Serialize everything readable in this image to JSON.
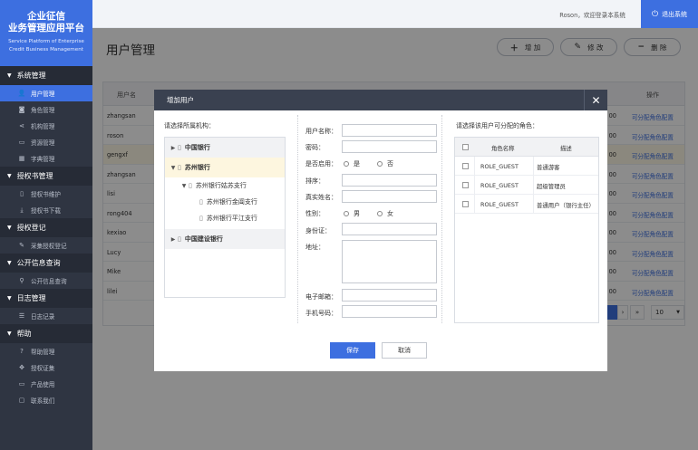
{
  "brand": {
    "title1": "企业征信",
    "title2": "业务管理应用平台",
    "sub1": "Service Platform of Enterprise",
    "sub2": "Credit Business Management"
  },
  "sidebar": {
    "groups": [
      {
        "label": "系统管理",
        "items": [
          {
            "label": "用户管理",
            "icon": "user-icon",
            "active": true
          },
          {
            "label": "角色管理",
            "icon": "role-icon"
          },
          {
            "label": "机构管理",
            "icon": "share-icon"
          },
          {
            "label": "资源管理",
            "icon": "folder-icon"
          },
          {
            "label": "字典管理",
            "icon": "calendar-icon"
          }
        ]
      },
      {
        "label": "授权书管理",
        "items": [
          {
            "label": "授权书维护",
            "icon": "document-icon"
          },
          {
            "label": "授权书下载",
            "icon": "download-icon"
          }
        ]
      },
      {
        "label": "授权登记",
        "items": [
          {
            "label": "采集授权登记",
            "icon": "pen-icon"
          }
        ]
      },
      {
        "label": "公开信息查询",
        "items": [
          {
            "label": "公开信息查询",
            "icon": "search-icon"
          }
        ]
      },
      {
        "label": "日志管理",
        "items": [
          {
            "label": "日志记录",
            "icon": "list-icon"
          }
        ]
      },
      {
        "label": "帮助",
        "items": [
          {
            "label": "帮助管理",
            "icon": "help-icon"
          },
          {
            "label": "授权证集",
            "icon": "move-icon"
          },
          {
            "label": "产品使用",
            "icon": "monitor-icon"
          },
          {
            "label": "联系我们",
            "icon": "chat-icon"
          }
        ]
      }
    ]
  },
  "topbar": {
    "welcome": "Roson，欢迎登录本系统",
    "logout": "退出系统"
  },
  "page": {
    "title": "用户管理",
    "add_label": "增 加",
    "edit_label": "修 改",
    "delete_label": "删 除"
  },
  "grid": {
    "header_name": "用户名",
    "header_op": "操作",
    "rows": [
      {
        "name": "zhangsan",
        "mid": "00",
        "op": "可分配角色配置"
      },
      {
        "name": "roson",
        "mid": "00",
        "op": "可分配角色配置"
      },
      {
        "name": "gengxf",
        "mid": "00",
        "op": "可分配角色配置"
      },
      {
        "name": "zhangsan",
        "mid": "00",
        "op": "可分配角色配置"
      },
      {
        "name": "lisi",
        "mid": "00",
        "op": "可分配角色配置"
      },
      {
        "name": "rong404",
        "mid": "00",
        "op": "可分配角色配置"
      },
      {
        "name": "kexiao",
        "mid": "00",
        "op": "可分配角色配置"
      },
      {
        "name": "Lucy",
        "mid": "00",
        "op": "可分配角色配置"
      },
      {
        "name": "Mike",
        "mid": "00",
        "op": "可分配角色配置"
      },
      {
        "name": "lilei",
        "mid": "00",
        "op": "可分配角色配置"
      }
    ],
    "pager_next": "›",
    "pager_last": "»",
    "page_size": "10"
  },
  "modal": {
    "title": "增加用户",
    "org_label": "请选择所属机构：",
    "tree": [
      "中国银行",
      "苏州银行",
      "苏州银行姑苏支行",
      "苏州银行金阊支行",
      "苏州银行平江支行",
      "中国建设银行"
    ],
    "form": {
      "username": "用户名称：",
      "password": "密码：",
      "enabled": "是否启用：",
      "yes": "是",
      "no": "否",
      "order": "排序：",
      "realname": "真实姓名：",
      "gender": "性别：",
      "male": "男",
      "female": "女",
      "idcard": "身份证：",
      "address": "地址：",
      "email": "电子邮箱：",
      "phone": "手机号码："
    },
    "role_label": "请选择该用户可分配的角色：",
    "role_header_name": "角色名称",
    "role_header_desc": "描述",
    "roles": [
      {
        "name": "ROLE_GUEST",
        "desc": "普通游客"
      },
      {
        "name": "ROLE_GUEST",
        "desc": "超级管理员"
      },
      {
        "name": "ROLE_GUEST",
        "desc": "普通用户（银行主任）"
      }
    ],
    "save": "保存",
    "cancel": "取消"
  }
}
